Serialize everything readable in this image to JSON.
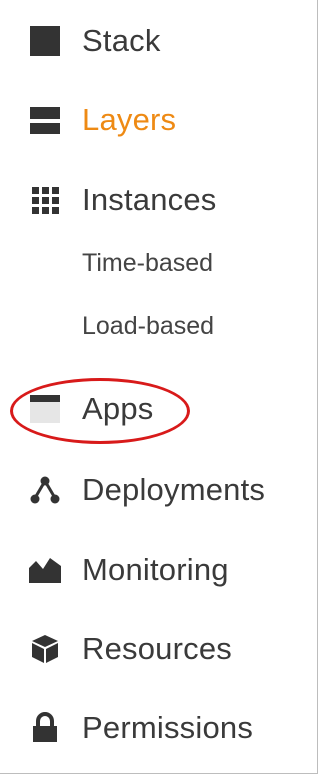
{
  "nav": {
    "items": [
      {
        "key": "stack",
        "label": "Stack",
        "icon": "square-icon"
      },
      {
        "key": "layers",
        "label": "Layers",
        "icon": "layers-icon",
        "active": true
      },
      {
        "key": "instances",
        "label": "Instances",
        "icon": "grid-icon"
      },
      {
        "key": "apps",
        "label": "Apps",
        "icon": "window-icon",
        "highlighted": true
      },
      {
        "key": "deployments",
        "label": "Deployments",
        "icon": "deployments-icon"
      },
      {
        "key": "monitoring",
        "label": "Monitoring",
        "icon": "monitoring-icon"
      },
      {
        "key": "resources",
        "label": "Resources",
        "icon": "cube-icon"
      },
      {
        "key": "permissions",
        "label": "Permissions",
        "icon": "lock-icon"
      }
    ],
    "instances_subitems": [
      {
        "label": "Time-based"
      },
      {
        "label": "Load-based"
      }
    ]
  },
  "colors": {
    "active": "#ee8a14",
    "text": "#3a3a3a",
    "icon": "#333333",
    "highlight_ring": "#d81a1a"
  }
}
